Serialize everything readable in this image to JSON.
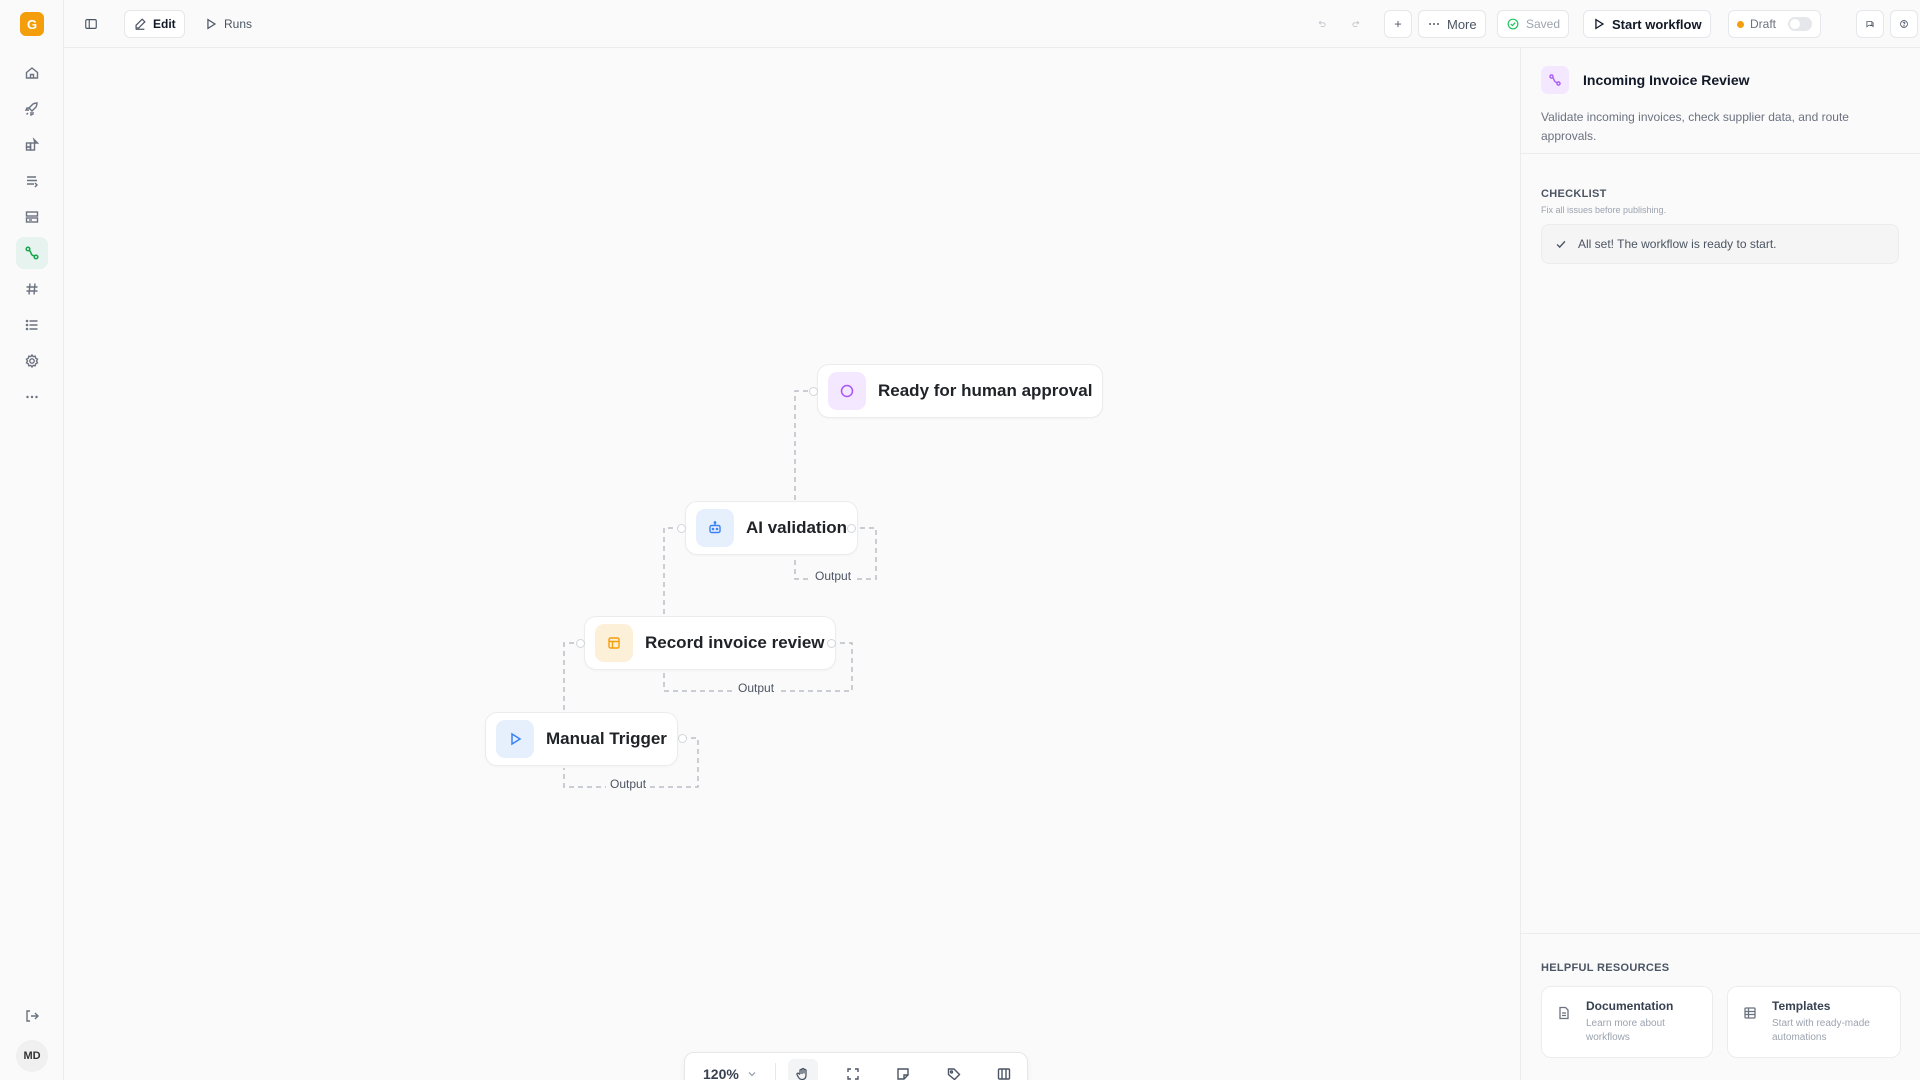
{
  "app": {
    "logo_letter": "G",
    "user_initials": "MD"
  },
  "sidebar": {
    "items": [
      {
        "icon": "home-icon"
      },
      {
        "icon": "rocket-icon"
      },
      {
        "icon": "apps-icon"
      },
      {
        "icon": "stack-icon"
      },
      {
        "icon": "layout-icon"
      },
      {
        "icon": "workflow-icon",
        "active": true
      },
      {
        "icon": "hash-icon"
      },
      {
        "icon": "list-icon"
      },
      {
        "icon": "settings-icon"
      },
      {
        "icon": "more-icon"
      }
    ],
    "bottom": [
      {
        "icon": "logout-icon"
      }
    ]
  },
  "toolbar": {
    "edit_label": "Edit",
    "runs_label": "Runs",
    "more_label": "More",
    "saved_label": "Saved",
    "start_label": "Start workflow",
    "draft_label": "Draft"
  },
  "canvas": {
    "nodes": [
      {
        "id": "approval",
        "label": "Ready for human approval",
        "icon": "circle-icon"
      },
      {
        "id": "ai",
        "label": "AI validation",
        "icon": "robot-icon"
      },
      {
        "id": "record",
        "label": "Record invoice review",
        "icon": "table-icon"
      },
      {
        "id": "trigger",
        "label": "Manual Trigger",
        "icon": "play-icon"
      }
    ],
    "output_labels": [
      "Output",
      "Output",
      "Output"
    ]
  },
  "zoom": {
    "level": "120%"
  },
  "panel": {
    "title": "Incoming Invoice Review",
    "description": "Validate incoming invoices, check supplier data, and route approvals.",
    "checklist_title": "CHECKLIST",
    "checklist_sub": "Fix all issues before publishing.",
    "checklist_status": "All set! The workflow is ready to start.",
    "resources_title": "HELPFUL RESOURCES",
    "resources": [
      {
        "title": "Documentation",
        "subtitle": "Learn more about workflows"
      },
      {
        "title": "Templates",
        "subtitle": "Start with ready-made automations"
      }
    ]
  },
  "colors": {
    "accent": "#f59e0b",
    "active_nav": "#16a34a",
    "workflow_purple": "#a855f7"
  }
}
